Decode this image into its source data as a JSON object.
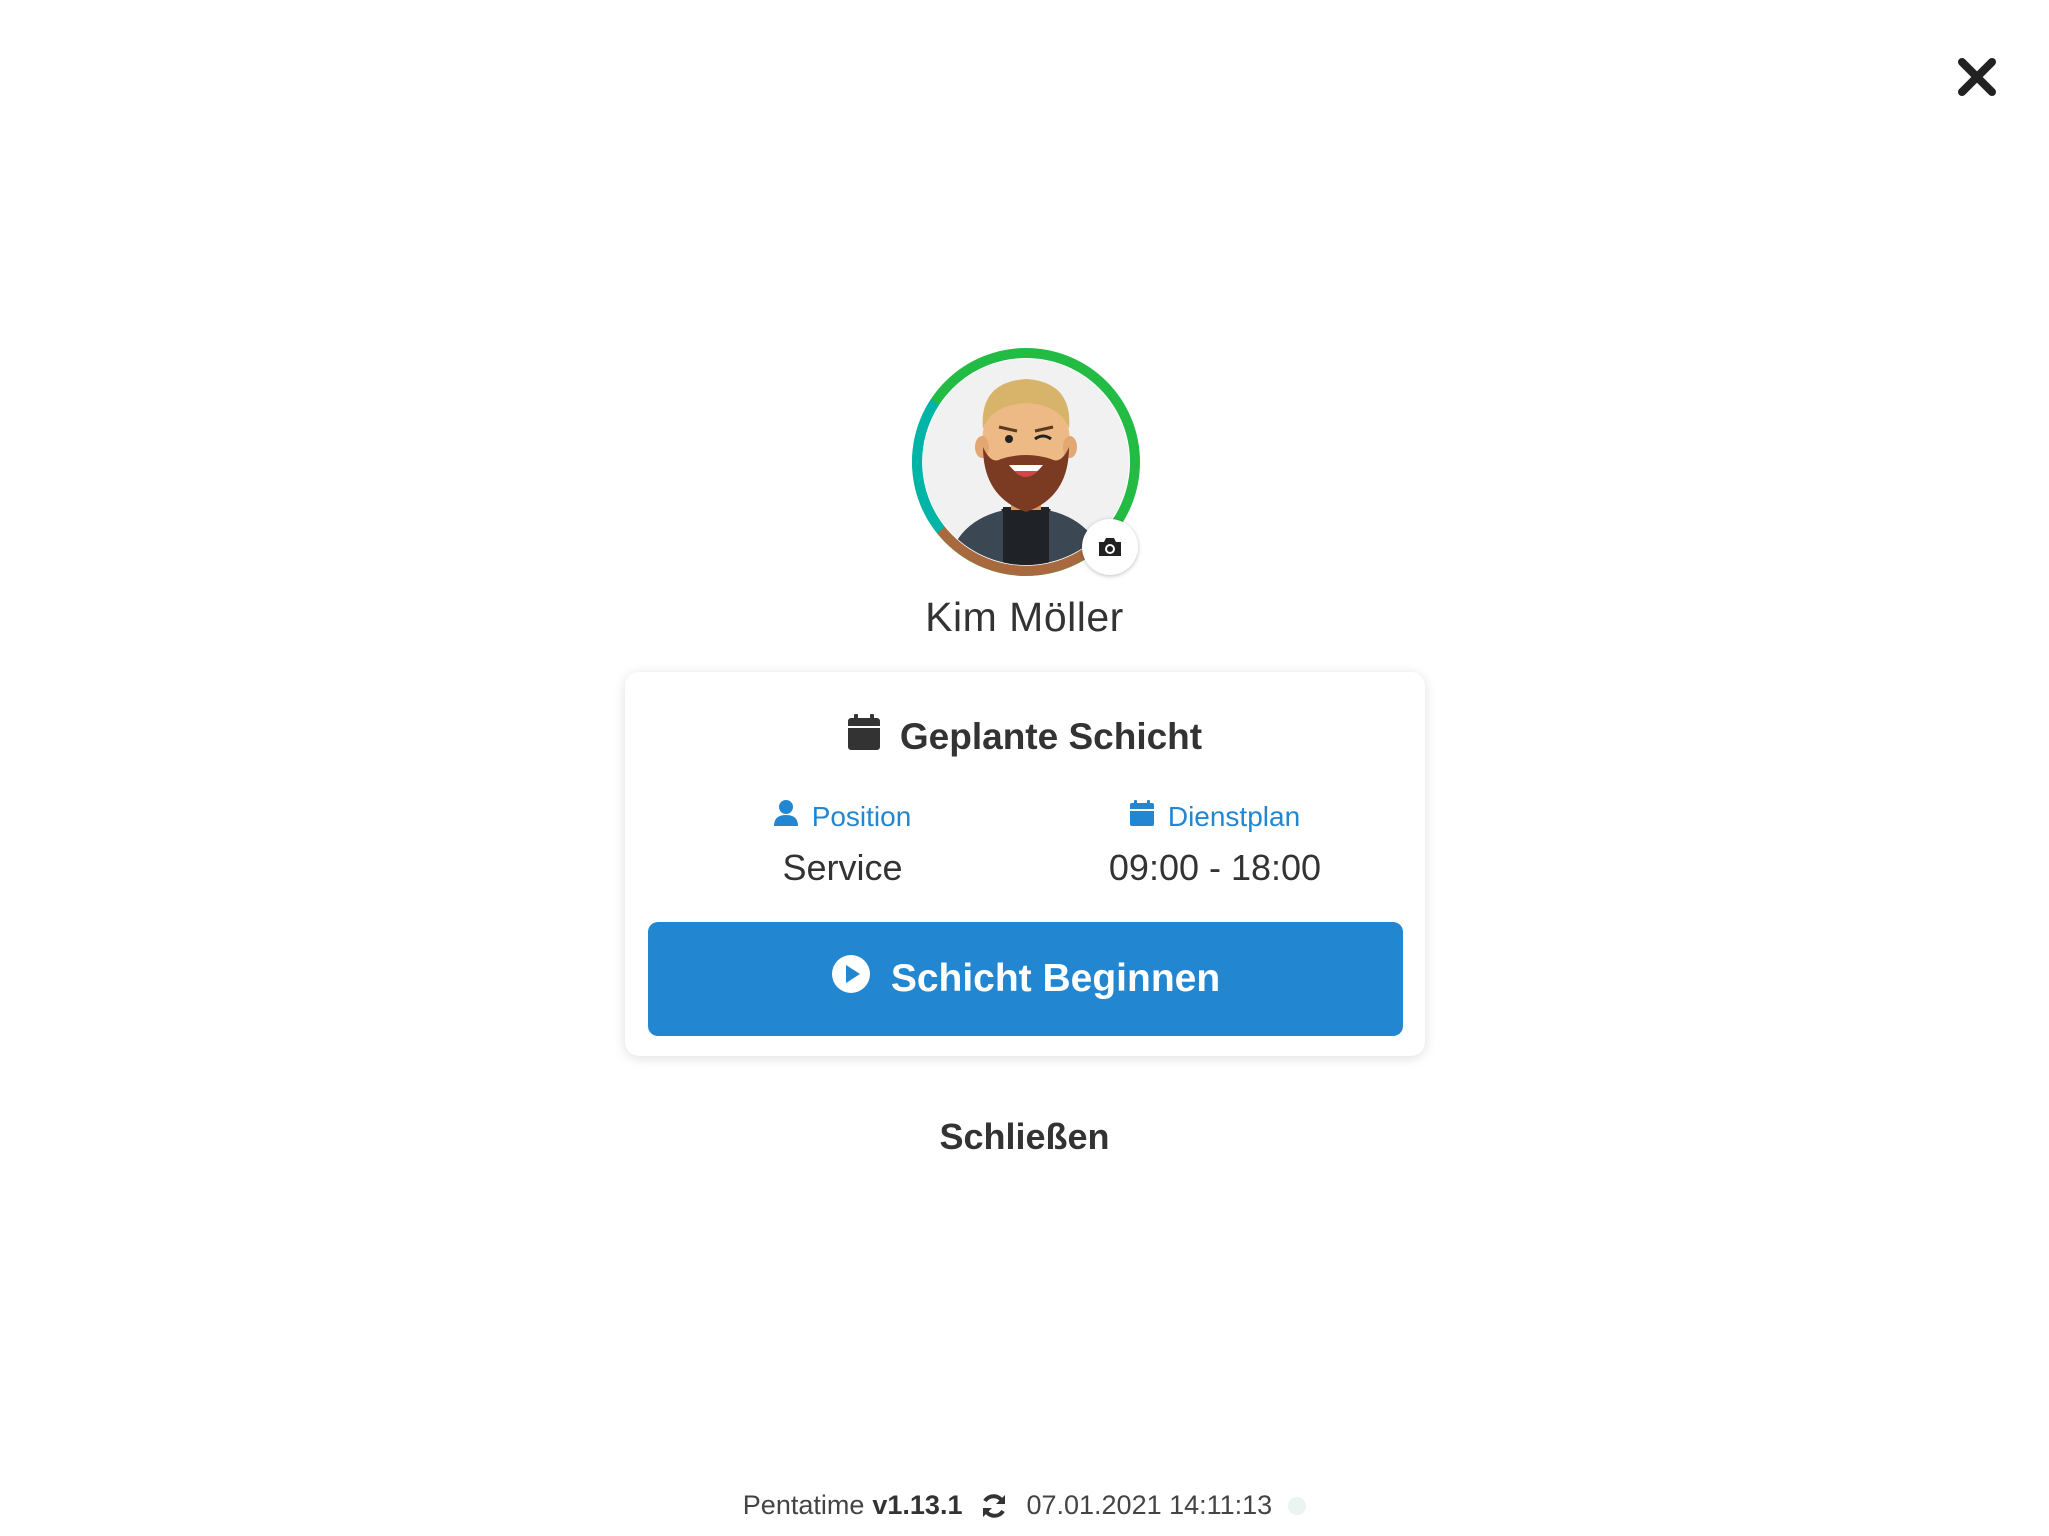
{
  "colors": {
    "accent": "#2386d1",
    "ring_green": "#22bb44",
    "ring_teal": "#00b5a8",
    "ring_brown": "#a8693f"
  },
  "window": {
    "close_icon": "close-icon"
  },
  "profile": {
    "name": "Kim Möller",
    "avatar": "bearded-man-avatar",
    "camera_icon": "camera-icon"
  },
  "shift_card": {
    "title": "Geplante Schicht",
    "title_icon": "calendar-icon",
    "position_label": "Position",
    "position_icon": "user-icon",
    "position_value": "Service",
    "schedule_label": "Dienstplan",
    "schedule_icon": "calendar-icon",
    "schedule_value": "09:00 - 18:00",
    "start_button_label": "Schicht Beginnen",
    "start_button_icon": "play-circle-icon"
  },
  "close_label": "Schließen",
  "footer": {
    "app_name": "Pentatime",
    "version": "v1.13.1",
    "refresh_icon": "refresh-icon",
    "timestamp": "07.01.2021 14:11:13"
  }
}
